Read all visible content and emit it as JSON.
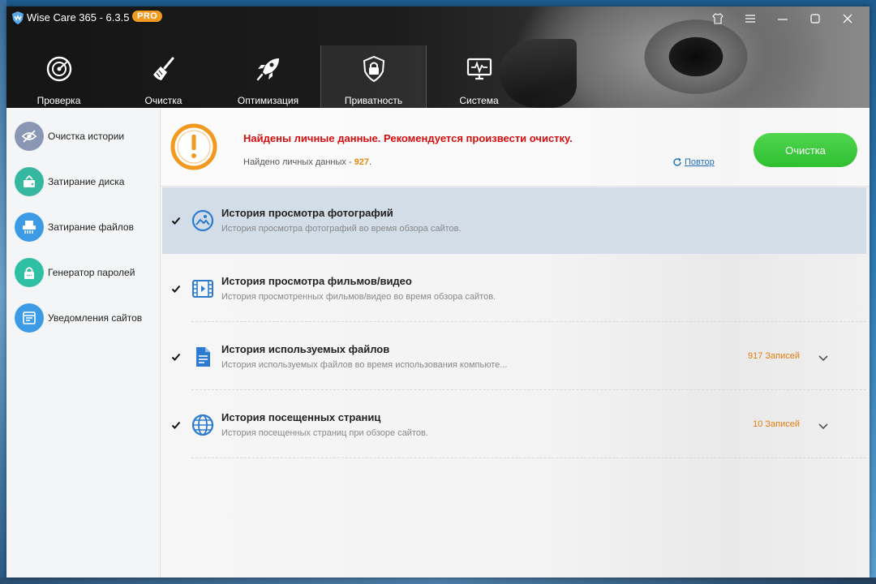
{
  "window": {
    "app_title": "Wise Care 365 - 6.3.5",
    "badge": "PRO"
  },
  "colors": {
    "accent_blue": "#3a8fd6",
    "orange": "#f29a1f",
    "danger": "#d40e0e",
    "green": "#3ac83a"
  },
  "nav": [
    {
      "label": "Проверка",
      "icon": "radar-icon"
    },
    {
      "label": "Очистка",
      "icon": "broom-icon"
    },
    {
      "label": "Оптимизация",
      "icon": "rocket-icon"
    },
    {
      "label": "Приватность",
      "icon": "lock-icon"
    },
    {
      "label": "Система",
      "icon": "monitor-icon"
    }
  ],
  "sidebar": {
    "items": [
      {
        "label": "Очистка истории",
        "icon": "eye-off-icon"
      },
      {
        "label": "Затирание диска",
        "icon": "disk-icon"
      },
      {
        "label": "Затирание файлов",
        "icon": "shredder-icon"
      },
      {
        "label": "Генератор паролей",
        "icon": "password-lock-icon"
      },
      {
        "label": "Уведомления сайтов",
        "icon": "notification-icon"
      }
    ]
  },
  "alert": {
    "title": "Найдены личные данные. Рекомендуется произвести очистку.",
    "found_label": "Найдено личных данных -",
    "found_count": "927",
    "found_suffix": ".",
    "repeat_label": "Повтор",
    "clean_button": "Очистка"
  },
  "items": [
    {
      "title": "История просмотра фотографий",
      "desc": "История просмотра фотографий во время обзора сайтов.",
      "count": "",
      "checked": true,
      "icon": "photo-icon"
    },
    {
      "title": "История просмотра фильмов/видео",
      "desc": "История просмотренных фильмов/видео во время обзора сайтов.",
      "count": "",
      "checked": true,
      "icon": "film-icon"
    },
    {
      "title": "История используемых файлов",
      "desc": "История используемых файлов во время использования компьюте...",
      "count": "917 Записей",
      "checked": true,
      "icon": "document-icon"
    },
    {
      "title": "История посещенных страниц",
      "desc": "История посещенных страниц при обзоре сайтов.",
      "count": "10 Записей",
      "checked": true,
      "icon": "globe-icon"
    }
  ]
}
